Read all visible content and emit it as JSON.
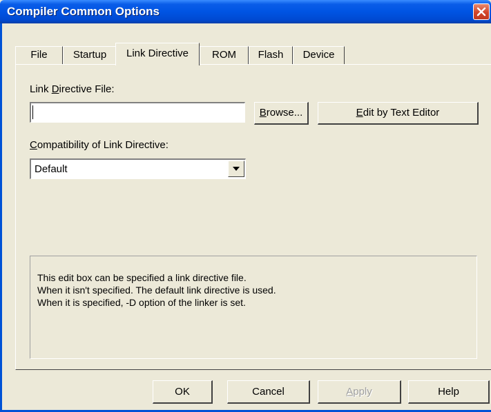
{
  "window": {
    "title": "Compiler Common Options"
  },
  "tabs": [
    {
      "label": "File",
      "active": false
    },
    {
      "label": "Startup",
      "active": false
    },
    {
      "label": "Link Directive",
      "active": true
    },
    {
      "label": "ROM",
      "active": false
    },
    {
      "label": "Flash",
      "active": false
    },
    {
      "label": "Device",
      "active": false
    }
  ],
  "link_directive": {
    "file_label_pre": "Link ",
    "file_label_mnemonic": "D",
    "file_label_post": "irective File:",
    "file_value": "",
    "browse_mnemonic": "B",
    "browse_rest": "rowse...",
    "edit_mnemonic": "E",
    "edit_rest": "dit by Text Editor",
    "compat_label_mnemonic": "C",
    "compat_label_rest": "ompatibility of Link Directive:",
    "compat_selected": "Default"
  },
  "description": [
    "This edit box can be specified a link directive file.",
    "When it isn't specified. The default link directive is used.",
    "When it is specified, -D option of the linker is set."
  ],
  "buttons": {
    "ok": "OK",
    "cancel": "Cancel",
    "apply_mnemonic": "A",
    "apply_rest": "pply",
    "help": "Help"
  },
  "colors": {
    "titlebar": "#0054E3",
    "face": "#ECE9D8",
    "close": "#D2452A"
  },
  "icons": {
    "close": "close-icon",
    "dropdown": "chevron-down-icon"
  }
}
